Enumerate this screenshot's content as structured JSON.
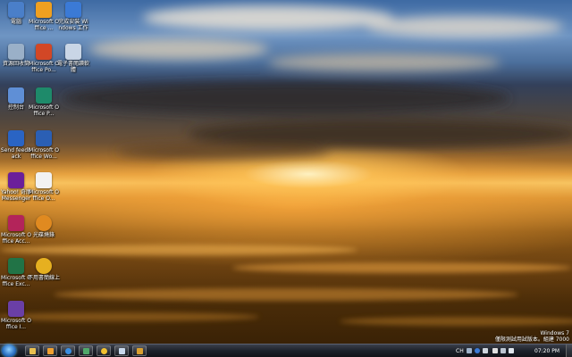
{
  "desktop": {
    "icons": [
      {
        "label": "電腦",
        "icon": "computer-icon",
        "color": "#4a7fc9"
      },
      {
        "label": "Microsoft Office ...",
        "icon": "office-outlook-icon",
        "color": "#f0a020"
      },
      {
        "label": "完成安裝 Windows 工作",
        "icon": "windows-tasks-icon",
        "color": "#3b7ad6"
      },
      {
        "label": "資源回收筒",
        "icon": "recycle-bin-icon",
        "color": "#9ab0c8"
      },
      {
        "label": "Microsoft Office Po...",
        "icon": "powerpoint-icon",
        "color": "#d24726"
      },
      {
        "label": "電子書閱讀軟體",
        "icon": "ebook-reader-icon",
        "color": "#c9d6e6"
      },
      {
        "label": "控制台",
        "icon": "control-panel-icon",
        "color": "#5f8fd6"
      },
      {
        "label": "Microsoft Office P...",
        "icon": "publisher-icon",
        "color": "#1e8a6a"
      },
      {
        "label": "Send feedback",
        "icon": "send-feedback-icon",
        "color": "#2a64c4"
      },
      {
        "label": "Microsoft Office Wo...",
        "icon": "word-icon",
        "color": "#2b5fb4"
      },
      {
        "label": "Yahoo! 奇摩 Messenger",
        "icon": "yahoo-messenger-icon",
        "color": "#6b1f9a"
      },
      {
        "label": "Microsoft Office O...",
        "icon": "onenote-icon",
        "color": "#f2f2f2"
      },
      {
        "label": "Microsoft Office Acc...",
        "icon": "access-icon",
        "color": "#b3245a"
      },
      {
        "label": "光碟燒錄",
        "icon": "disc-burner-icon",
        "color": "#e08a20"
      },
      {
        "label": "Microsoft Office Exc...",
        "icon": "excel-icon",
        "color": "#217346"
      },
      {
        "label": "不用書簡線上",
        "icon": "online-tool-icon",
        "color": "#e6b020"
      },
      {
        "label": "Microsoft Office I...",
        "icon": "infopath-icon",
        "color": "#6a3fa6"
      }
    ]
  },
  "watermark": {
    "line1": "Windows 7",
    "line2": "僅限測試用試版本。組建 7000"
  },
  "taskbar": {
    "buttons": [
      {
        "icon": "windows-explorer-icon",
        "color": "#e8c050"
      },
      {
        "icon": "media-player-icon",
        "color": "#f0a030"
      },
      {
        "icon": "internet-explorer-icon",
        "color": "#3b8ee0"
      },
      {
        "icon": "network-icon",
        "color": "#4fa86a"
      },
      {
        "icon": "messenger-icon",
        "color": "#f2c230"
      },
      {
        "icon": "document-icon",
        "color": "#c8d8ec"
      },
      {
        "icon": "paint-icon",
        "color": "#d9a030"
      }
    ],
    "tray": {
      "language": "CH",
      "clock": "07:20 PM"
    }
  }
}
